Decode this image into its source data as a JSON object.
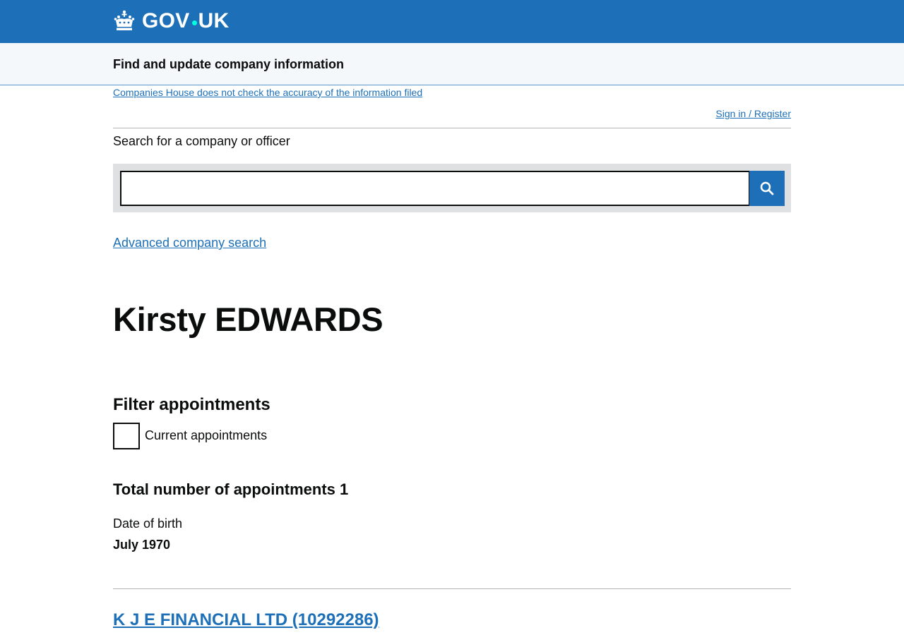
{
  "header": {
    "logo_text_left": "GOV",
    "logo_text_right": "UK",
    "crown_icon": "crown-icon",
    "colors": {
      "header_bg": "#1d70b8",
      "logo_dot": "#00ffe0",
      "link": "#1d70b8"
    }
  },
  "service": {
    "name": "Find and update company information"
  },
  "notices": {
    "accuracy_link": "Companies House does not check the accuracy of the information filed",
    "signin_link": "Sign in / Register"
  },
  "search": {
    "label": "Search for a company or officer",
    "value": "",
    "button_icon": "search-icon",
    "advanced_link": "Advanced company search"
  },
  "officer": {
    "name": "Kirsty EDWARDS"
  },
  "filter": {
    "heading": "Filter appointments",
    "checkbox_label": "Current appointments",
    "checked": false
  },
  "appointments": {
    "total_heading": "Total number of appointments 1",
    "dob_label": "Date of birth",
    "dob_value": "July 1970",
    "items": [
      {
        "company_link": "K J E FINANCIAL LTD (10292286)"
      }
    ]
  }
}
